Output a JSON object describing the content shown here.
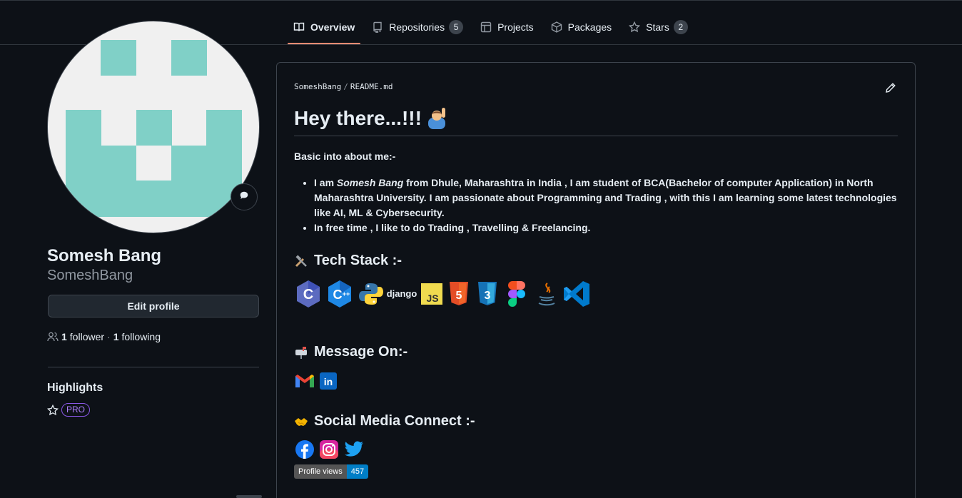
{
  "tabs": [
    {
      "label": "Overview",
      "icon": "book-icon",
      "active": true
    },
    {
      "label": "Repositories",
      "icon": "repo-icon",
      "count": "5"
    },
    {
      "label": "Projects",
      "icon": "table-icon"
    },
    {
      "label": "Packages",
      "icon": "package-icon"
    },
    {
      "label": "Stars",
      "icon": "star-icon",
      "count": "2"
    }
  ],
  "profile": {
    "name": "Somesh Bang",
    "login": "SomeshBang",
    "edit_label": "Edit profile",
    "followers_count": "1",
    "followers_label": "follower",
    "dot": "·",
    "following_count": "1",
    "following_label": "following",
    "highlights_title": "Highlights",
    "pro_label": "PRO"
  },
  "readme": {
    "owner": "SomeshBang",
    "sep": "/",
    "file": "README.md",
    "heading": "Hey there...!!!",
    "basic": "Basic into about me:-",
    "bio1_a": "I am ",
    "bio1_name": "Somesh Bang",
    "bio1_b": " from Dhule, Maharashtra in India , I am student of BCA(Bachelor of computer Application) in North Maharashtra University. I am passionate about Programming and Trading , with this I am learning some latest technologies like AI, ML & Cybersecurity.",
    "bio2": "In free time , I like to do Trading , Travelling & Freelancing.",
    "tech_title": "Tech Stack :-",
    "message_title": "Message On:-",
    "social_title": "Social Media Connect :-",
    "views_label": "Profile views",
    "views_count": "457"
  },
  "tech_icons": [
    "c-icon",
    "cpp-icon",
    "python-icon",
    "django-icon",
    "javascript-icon",
    "html5-icon",
    "css3-icon",
    "figma-icon",
    "java-icon",
    "vscode-icon"
  ],
  "colors": {
    "accent": "#fd8c73",
    "bg": "#0d1117",
    "border": "#3d444d",
    "pro": "#ab7df8",
    "avatar": "#80d0c7"
  }
}
